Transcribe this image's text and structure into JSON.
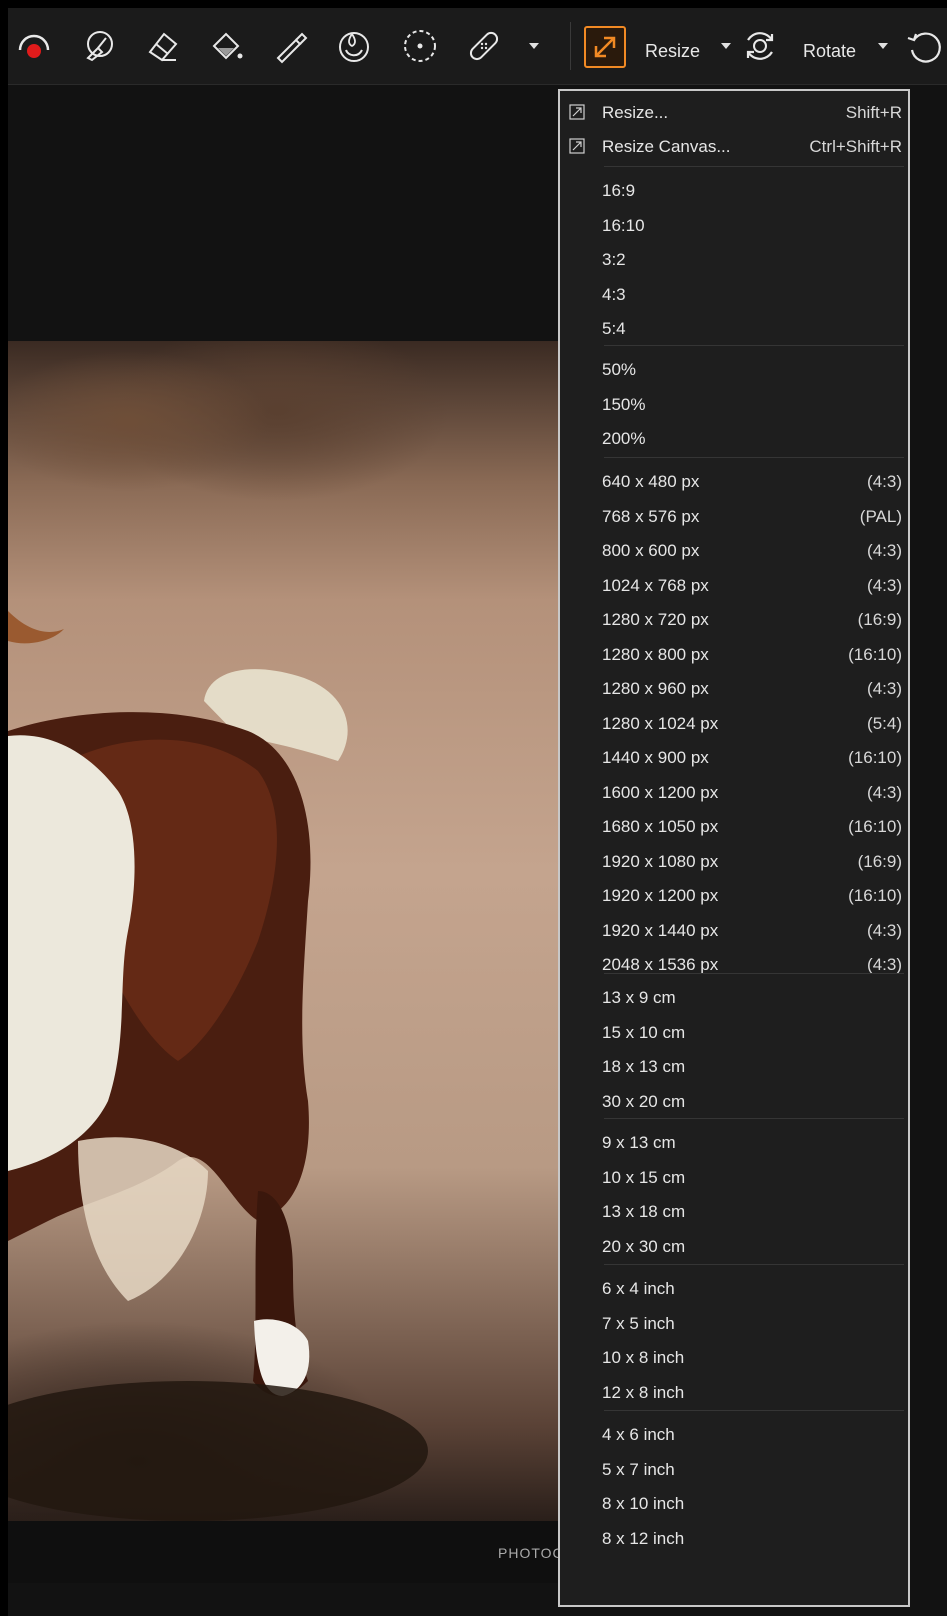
{
  "toolbar": {
    "icons": [
      "red-eye-icon",
      "pen-draw-icon",
      "eraser-icon",
      "fill-bucket-icon",
      "pipette-icon",
      "blur-drop-icon",
      "selection-circle-icon",
      "bandage-icon",
      "resize-icon",
      "rotate-icon",
      "undo-icon"
    ],
    "resize_label": "Resize",
    "rotate_label": "Rotate"
  },
  "photo": {
    "watermark": "PHOTOC"
  },
  "menu": {
    "resize": {
      "label": "Resize...",
      "shortcut": "Shift+R"
    },
    "resize_canvas": {
      "label": "Resize Canvas...",
      "shortcut": "Ctrl+Shift+R"
    },
    "ratios": [
      "16:9",
      "16:10",
      "3:2",
      "4:3",
      "5:4"
    ],
    "percents": [
      "50%",
      "150%",
      "200%"
    ],
    "pixels": [
      {
        "label": "640 x 480 px",
        "ratio": "(4:3)"
      },
      {
        "label": "768 x 576 px",
        "ratio": "(PAL)"
      },
      {
        "label": "800 x 600 px",
        "ratio": "(4:3)"
      },
      {
        "label": "1024 x 768 px",
        "ratio": "(4:3)"
      },
      {
        "label": "1280 x 720 px",
        "ratio": "(16:9)"
      },
      {
        "label": "1280 x 800 px",
        "ratio": "(16:10)"
      },
      {
        "label": "1280 x 960 px",
        "ratio": "(4:3)"
      },
      {
        "label": "1280 x 1024 px",
        "ratio": "(5:4)"
      },
      {
        "label": "1440 x 900 px",
        "ratio": "(16:10)"
      },
      {
        "label": "1600 x 1200 px",
        "ratio": "(4:3)"
      },
      {
        "label": "1680 x 1050 px",
        "ratio": "(16:10)"
      },
      {
        "label": "1920 x 1080 px",
        "ratio": "(16:9)"
      },
      {
        "label": "1920 x 1200 px",
        "ratio": "(16:10)"
      },
      {
        "label": "1920 x 1440 px",
        "ratio": "(4:3)"
      },
      {
        "label": "2048 x 1536 px",
        "ratio": "(4:3)"
      }
    ],
    "cm_landscape": [
      "13 x 9 cm",
      "15 x 10 cm",
      "18 x 13 cm",
      "30 x 20 cm"
    ],
    "cm_portrait": [
      "9 x 13 cm",
      "10 x 15 cm",
      "13 x 18 cm",
      "20 x 30 cm"
    ],
    "inch_landscape": [
      "6 x 4 inch",
      "7 x 5 inch",
      "10 x 8 inch",
      "12 x 8 inch"
    ],
    "inch_portrait": [
      "4 x 6 inch",
      "5 x 7 inch",
      "8 x 10 inch",
      "8 x 12 inch"
    ]
  },
  "colors": {
    "accent": "#f28a24",
    "menu_bg": "#1e1e1e",
    "toolbar_bg": "#1b1b1b"
  }
}
